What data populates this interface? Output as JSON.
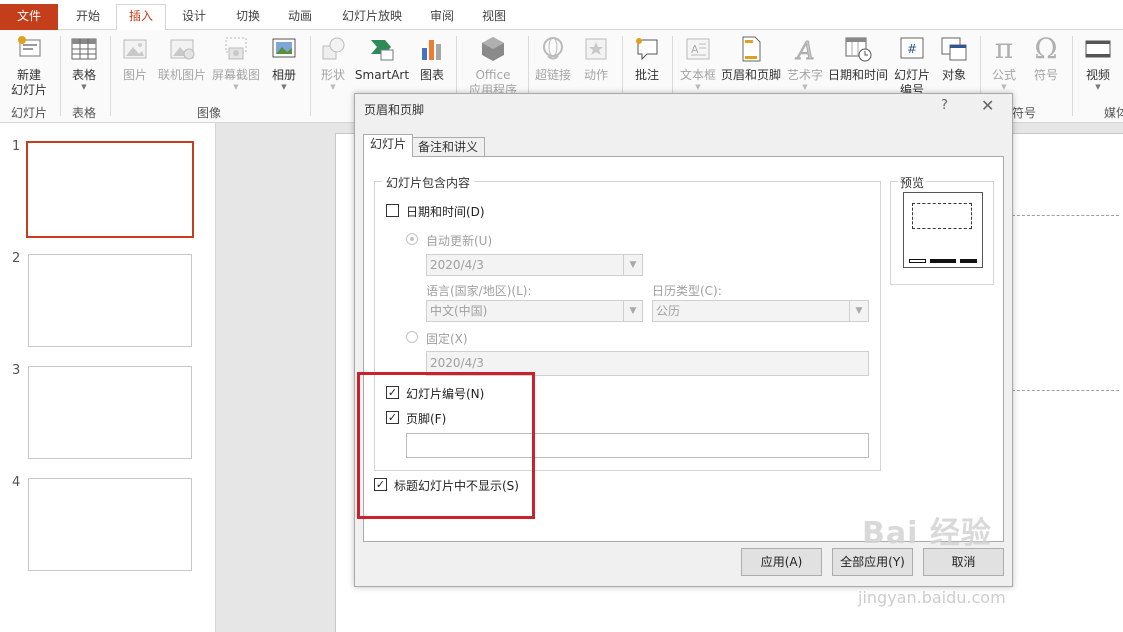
{
  "tabs": [
    "文件",
    "开始",
    "插入",
    "设计",
    "切换",
    "动画",
    "幻灯片放映",
    "审阅",
    "视图"
  ],
  "ribbon": {
    "new_slide": "新建",
    "new_slide2": "幻灯片",
    "table": "表格",
    "picture": "图片",
    "online_picture": "联机图片",
    "screenshot": "屏幕截图",
    "album": "相册",
    "shape": "形状",
    "smartart": "SmartArt",
    "chart": "图表",
    "office": "Office",
    "office2": "应用程序",
    "hyperlink": "超链接",
    "action": "动作",
    "comment": "批注",
    "textbox": "文本框",
    "header_footer": "页眉和页脚",
    "wordart": "艺术字",
    "datetime": "日期和时间",
    "slide_number": "幻灯片",
    "slide_number2": "编号",
    "object": "对象",
    "equation": "公式",
    "symbol": "符号",
    "video": "视频",
    "groups": {
      "slides": "幻灯片",
      "tables": "表格",
      "images": "图像",
      "symbols": "符号",
      "media": "媒体"
    }
  },
  "thumbnails": [
    "1",
    "2",
    "3",
    "4"
  ],
  "dialog": {
    "title": "页眉和页脚",
    "help": "?",
    "close": "✕",
    "tab_slide": "幻灯片",
    "tab_notes": "备注和讲义",
    "group_label": "幻灯片包含内容",
    "preview_label": "预览",
    "datetime_label": "日期和时间(D)",
    "auto_update_label": "自动更新(U)",
    "auto_date": "2020/4/3",
    "language_label": "语言(国家/地区)(L):",
    "language_value": "中文(中国)",
    "calendar_label": "日历类型(C):",
    "calendar_value": "公历",
    "fixed_label": "固定(X)",
    "fixed_value": "2020/4/3",
    "slide_number_label": "幻灯片编号(N)",
    "footer_label": "页脚(F)",
    "footer_value": "",
    "hide_title_label": "标题幻灯片中不显示(S)",
    "apply_button": "应用(A)",
    "apply_all_button": "全部应用(Y)",
    "cancel_button": "取消"
  },
  "watermark": {
    "brand": "Bai 经验",
    "url": "jingyan.baidu.com"
  },
  "colors": {
    "accent": "#c43e1c",
    "highlight": "#c8232c"
  }
}
